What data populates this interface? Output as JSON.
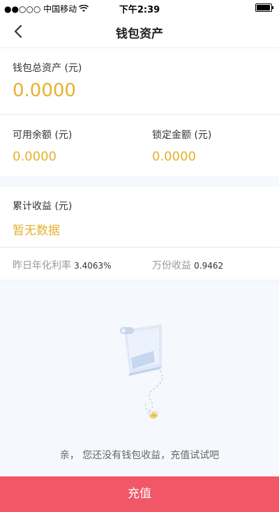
{
  "status_bar": {
    "carrier": "●●○○○ 中国移动",
    "time": "下午2:39"
  },
  "nav": {
    "title": "钱包资产"
  },
  "total": {
    "label": "钱包总资产 (元)",
    "value": "0.0000"
  },
  "balances": {
    "available_label": "可用余额 (元)",
    "available_value": "0.0000",
    "locked_label": "锁定金额 (元)",
    "locked_value": "0.0000"
  },
  "earnings": {
    "label": "累计收益 (元)",
    "value": "暂无数据"
  },
  "rates": {
    "annual_label": "昨日年化利率",
    "annual_value": "3.4063%",
    "per_10k_label": "万份收益",
    "per_10k_value": "0.9462"
  },
  "empty_state": {
    "message": "亲， 您还没有钱包收益，充值试试吧"
  },
  "actions": {
    "recharge_label": "充值"
  },
  "colors": {
    "accent_gold": "#e6b12e",
    "button_red": "#f25768"
  }
}
